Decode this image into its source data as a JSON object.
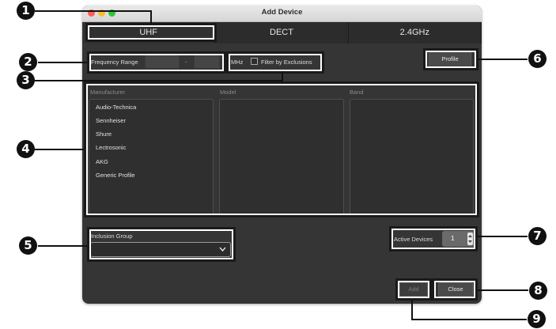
{
  "window": {
    "title": "Add Device"
  },
  "tabs": [
    {
      "label": "UHF",
      "active": true
    },
    {
      "label": "DECT",
      "active": false
    },
    {
      "label": "2.4GHz",
      "active": false
    }
  ],
  "frequency": {
    "label": "Frequency Range",
    "separator": "-",
    "unit": "MHz",
    "from": "",
    "to": ""
  },
  "filter": {
    "label": "Filter by Exclusions",
    "checked": false
  },
  "profile_button": "Profile",
  "columns": {
    "manufacturer": "Manufacturer",
    "model": "Model",
    "band": "Band"
  },
  "manufacturers": [
    "Audio-Technica",
    "Sennheiser",
    "Shure",
    "Lectrosonic",
    "AKG",
    "Generic Profile"
  ],
  "inclusion_group": {
    "label": "Inclusion Group",
    "value": ""
  },
  "active_devices": {
    "label": "Active Devices",
    "value": "1"
  },
  "buttons": {
    "add": "Add",
    "close": "Close"
  },
  "callouts": [
    "1",
    "2",
    "3",
    "4",
    "5",
    "6",
    "7",
    "8",
    "9"
  ],
  "colors": {
    "window_bg": "#353535",
    "callout": "#111111",
    "highlight": "#ffffff"
  }
}
